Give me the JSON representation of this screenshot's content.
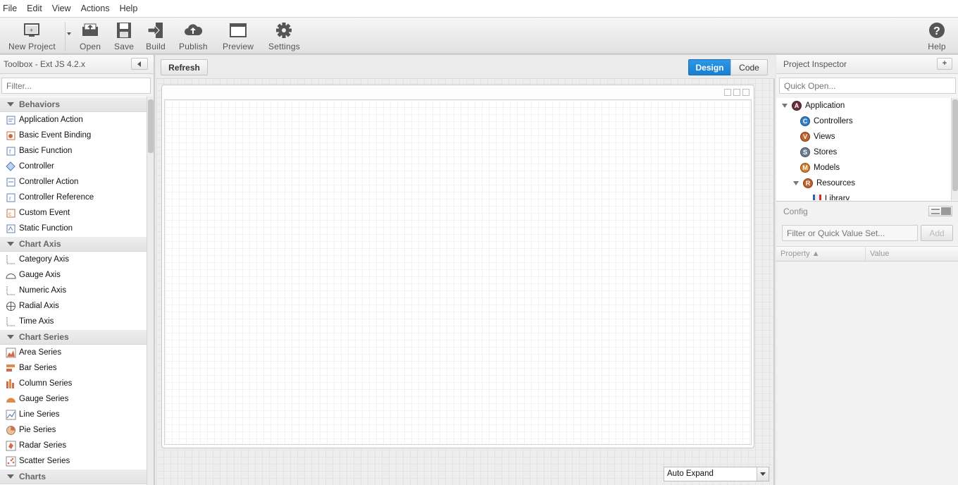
{
  "menu": [
    "File",
    "Edit",
    "View",
    "Actions",
    "Help"
  ],
  "toolbar": {
    "new_project": "New Project",
    "open": "Open",
    "save": "Save",
    "build": "Build",
    "publish": "Publish",
    "preview": "Preview",
    "settings": "Settings",
    "help": "Help"
  },
  "toolbox": {
    "title": "Toolbox - Ext JS 4.2.x",
    "filter_placeholder": "Filter...",
    "groups": [
      {
        "label": "Behaviors",
        "items": [
          "Application Action",
          "Basic Event Binding",
          "Basic Function",
          "Controller",
          "Controller Action",
          "Controller Reference",
          "Custom Event",
          "Static Function"
        ]
      },
      {
        "label": "Chart Axis",
        "items": [
          "Category Axis",
          "Gauge Axis",
          "Numeric Axis",
          "Radial Axis",
          "Time Axis"
        ]
      },
      {
        "label": "Chart Series",
        "items": [
          "Area Series",
          "Bar Series",
          "Column Series",
          "Gauge Series",
          "Line Series",
          "Pie Series",
          "Radar Series",
          "Scatter Series"
        ]
      },
      {
        "label": "Charts",
        "items": []
      }
    ]
  },
  "canvas": {
    "refresh": "Refresh",
    "design": "Design",
    "code": "Code",
    "expand_mode": "Auto Expand"
  },
  "inspector": {
    "title": "Project Inspector",
    "add": "+",
    "quick_open_placeholder": "Quick Open...",
    "nodes": [
      {
        "label": "Application",
        "badge": "A",
        "color": "#6a2f3f"
      },
      {
        "label": "Controllers",
        "badge": "C",
        "color": "#2f7fc9"
      },
      {
        "label": "Views",
        "badge": "V",
        "color": "#c0622b"
      },
      {
        "label": "Stores",
        "badge": "S",
        "color": "#6d7a93"
      },
      {
        "label": "Models",
        "badge": "M",
        "color": "#d37c2c"
      },
      {
        "label": "Resources",
        "badge": "R",
        "color": "#c0622b"
      },
      {
        "label": "Library",
        "badge": "",
        "color": "#3b5ea8"
      }
    ]
  },
  "config": {
    "title": "Config",
    "filter_placeholder": "Filter or Quick Value Set...",
    "add": "Add",
    "col_property": "Property ▲",
    "col_value": "Value"
  }
}
